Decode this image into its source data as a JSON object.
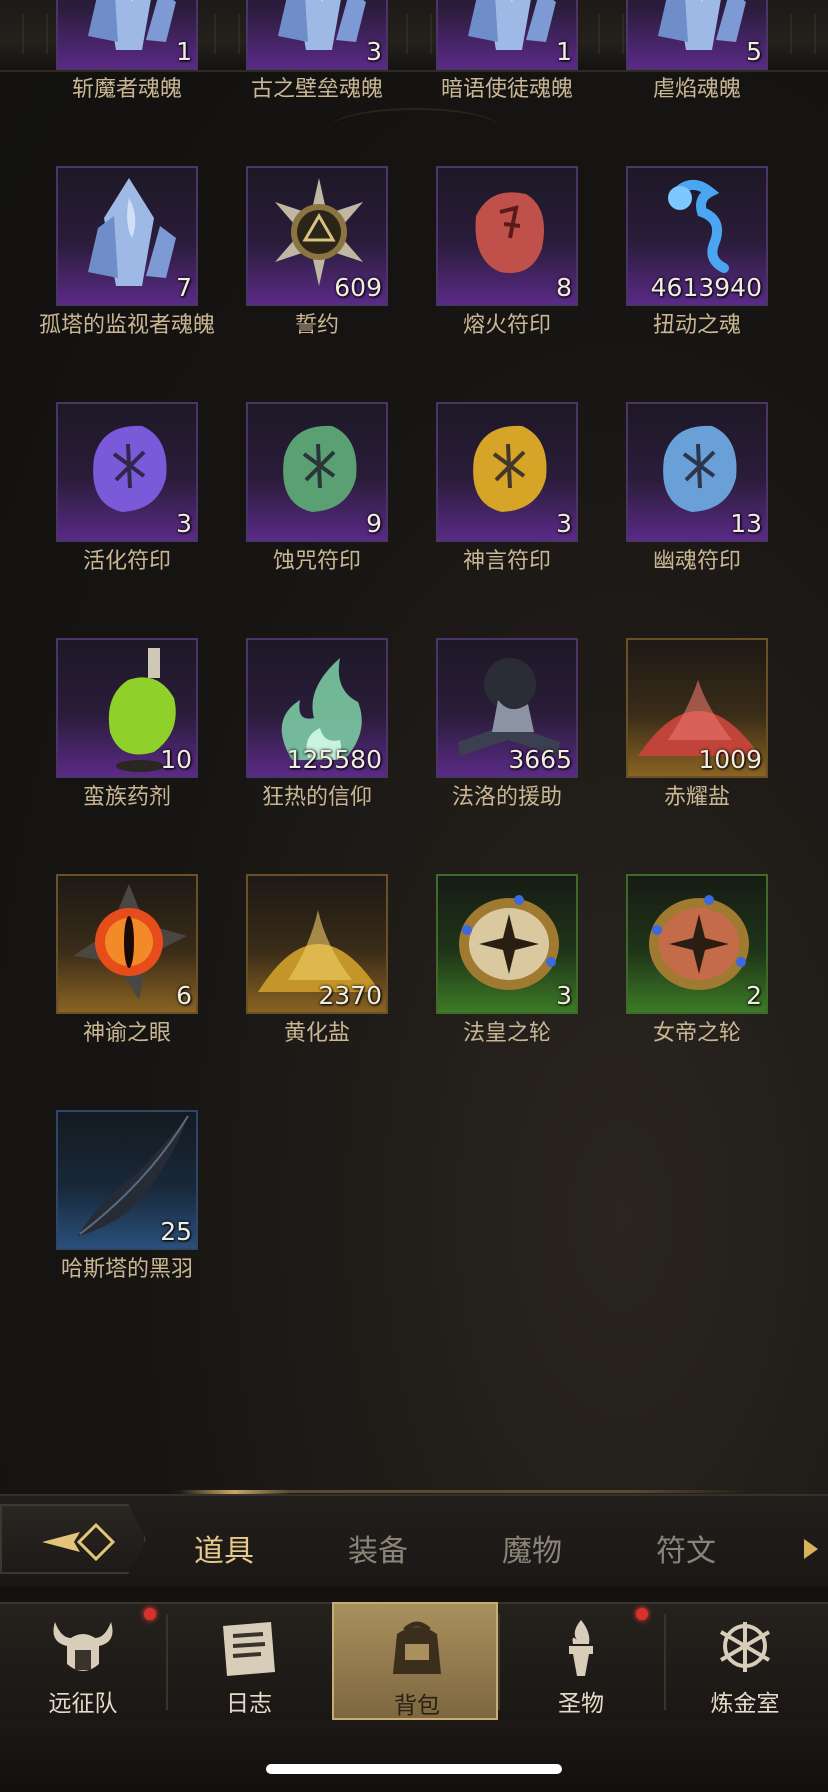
{
  "colors": {
    "accent": "#e6c98a",
    "rarity_purple": "#5a2a86",
    "rarity_gold": "#8a6322",
    "rarity_green": "#3c7a26",
    "rarity_blue": "#2a4f7a",
    "notification": "#d8302a"
  },
  "inventory": {
    "items": [
      {
        "name": "斩魔者魂魄",
        "count": "1",
        "rarity": "purple",
        "icon": "crystal-soul-icon"
      },
      {
        "name": "古之壁垒魂魄",
        "count": "3",
        "rarity": "purple",
        "icon": "crystal-soul-icon"
      },
      {
        "name": "暗语使徒魂魄",
        "count": "1",
        "rarity": "purple",
        "icon": "crystal-soul-icon"
      },
      {
        "name": "虐焰魂魄",
        "count": "5",
        "rarity": "purple",
        "icon": "crystal-soul-icon"
      },
      {
        "name": "孤塔的监视者魂魄",
        "count": "7",
        "rarity": "purple",
        "icon": "crystal-soul-icon"
      },
      {
        "name": "誓约",
        "count": "609",
        "rarity": "purple",
        "icon": "star-seal-icon"
      },
      {
        "name": "熔火符印",
        "count": "8",
        "rarity": "purple",
        "icon": "red-rune-stone-icon"
      },
      {
        "name": "扭动之魂",
        "count": "4613940",
        "rarity": "purple",
        "icon": "blue-wisp-icon"
      },
      {
        "name": "活化符印",
        "count": "3",
        "rarity": "purple",
        "icon": "purple-rune-stone-icon"
      },
      {
        "name": "蚀咒符印",
        "count": "9",
        "rarity": "purple",
        "icon": "green-rune-stone-icon"
      },
      {
        "name": "神言符印",
        "count": "3",
        "rarity": "purple",
        "icon": "yellow-rune-stone-icon"
      },
      {
        "name": "幽魂符印",
        "count": "13",
        "rarity": "purple",
        "icon": "blue-rune-stone-icon"
      },
      {
        "name": "蛮族药剂",
        "count": "10",
        "rarity": "purple",
        "icon": "potion-flask-icon"
      },
      {
        "name": "狂热的信仰",
        "count": "125580",
        "rarity": "purple",
        "icon": "green-flame-icon"
      },
      {
        "name": "法洛的援助",
        "count": "3665",
        "rarity": "purple",
        "icon": "hooded-book-icon"
      },
      {
        "name": "赤耀盐",
        "count": "1009",
        "rarity": "gold",
        "icon": "red-salt-pile-icon"
      },
      {
        "name": "神谕之眼",
        "count": "6",
        "rarity": "gold",
        "icon": "demon-eye-icon"
      },
      {
        "name": "黄化盐",
        "count": "2370",
        "rarity": "gold",
        "icon": "gold-salt-pile-icon"
      },
      {
        "name": "法皇之轮",
        "count": "3",
        "rarity": "green",
        "icon": "gold-compass-wheel-icon"
      },
      {
        "name": "女帝之轮",
        "count": "2",
        "rarity": "green",
        "icon": "red-compass-wheel-icon"
      },
      {
        "name": "哈斯塔的黑羽",
        "count": "25",
        "rarity": "blue",
        "icon": "black-feather-icon"
      }
    ]
  },
  "category_tabs": [
    {
      "label": "道具",
      "active": true
    },
    {
      "label": "装备",
      "active": false
    },
    {
      "label": "魔物",
      "active": false
    },
    {
      "label": "符文",
      "active": false
    }
  ],
  "bottom_nav": [
    {
      "label": "远征队",
      "icon": "horned-helmet-icon",
      "badge": true,
      "active": false
    },
    {
      "label": "日志",
      "icon": "scroll-log-icon",
      "badge": false,
      "active": false
    },
    {
      "label": "背包",
      "icon": "backpack-icon",
      "badge": false,
      "active": true
    },
    {
      "label": "圣物",
      "icon": "torch-relic-icon",
      "badge": true,
      "active": false
    },
    {
      "label": "炼金室",
      "icon": "alchemy-symbol-icon",
      "badge": false,
      "active": false
    }
  ]
}
